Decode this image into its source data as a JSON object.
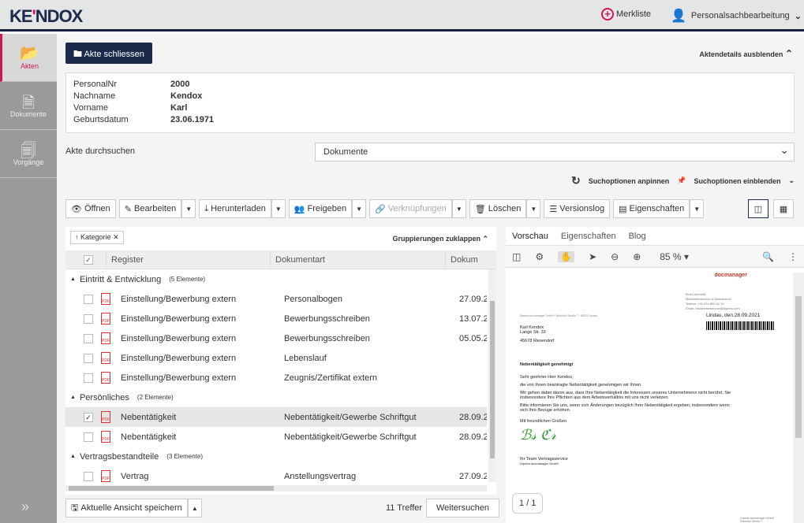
{
  "header": {
    "logo": "KENDOX",
    "merkliste": "Merkliste",
    "user": "Personalsachbearbeitung"
  },
  "sidebar": {
    "items": [
      {
        "label": "Akten",
        "icon": "folder-open-icon"
      },
      {
        "label": "Dokumente",
        "icon": "document-icon"
      },
      {
        "label": "Vorgänge",
        "icon": "process-icon"
      }
    ]
  },
  "main": {
    "close_button": "Akte schliessen",
    "details_toggle": "Aktendetails ausblenden",
    "details": [
      {
        "label": "PersonalNr",
        "value": "2000"
      },
      {
        "label": "Nachname",
        "value": "Kendox"
      },
      {
        "label": "Vorname",
        "value": "Karl"
      },
      {
        "label": "Geburtsdatum",
        "value": "23.06.1971"
      }
    ],
    "search_label": "Akte durchsuchen",
    "search_select": "Dokumente",
    "pin_options": "Suchoptionen anpinnen",
    "show_options": "Suchoptionen einblenden",
    "toolbar": {
      "open": "Öffnen",
      "edit": "Bearbeiten",
      "download": "Herunterladen",
      "share": "Freigeben",
      "links": "Verknüpfungen",
      "delete": "Löschen",
      "versionlog": "Versionslog",
      "properties": "Eigenschaften"
    },
    "list": {
      "chip": "Kategorie",
      "collapse_groups": "Gruppierungen zuklappen",
      "columns": [
        "Register",
        "Dokumentart",
        "Dokum"
      ],
      "groups": [
        {
          "name": "Eintritt & Entwicklung",
          "count": "(5 Elemente)",
          "rows": [
            {
              "register": "Einstellung/Bewerbung extern",
              "type": "Personalbogen",
              "date": "27.09.2",
              "checked": false
            },
            {
              "register": "Einstellung/Bewerbung extern",
              "type": "Bewerbungsschreiben",
              "date": "13.07.2",
              "checked": false
            },
            {
              "register": "Einstellung/Bewerbung extern",
              "type": "Bewerbungsschreiben",
              "date": "05.05.2",
              "checked": false
            },
            {
              "register": "Einstellung/Bewerbung extern",
              "type": "Lebenslauf",
              "date": "",
              "checked": false
            },
            {
              "register": "Einstellung/Bewerbung extern",
              "type": "Zeugnis/Zertifikat extern",
              "date": "",
              "checked": false
            }
          ]
        },
        {
          "name": "Persönliches",
          "count": "(2 Elemente)",
          "rows": [
            {
              "register": "Nebentätigkeit",
              "type": "Nebentätigkeit/Gewerbe Schriftgut",
              "date": "28.09.2",
              "checked": true
            },
            {
              "register": "Nebentätigkeit",
              "type": "Nebentätigkeit/Gewerbe Schriftgut",
              "date": "28.09.2",
              "checked": false
            }
          ]
        },
        {
          "name": "Vertragsbestandteile",
          "count": "(3 Elemente)",
          "rows": [
            {
              "register": "Vertrag",
              "type": "Anstellungsvertrag",
              "date": "27.09.2",
              "checked": false
            }
          ]
        }
      ]
    },
    "save_view": "Aktuelle Ansicht speichern",
    "hits": "11 Treffer",
    "search_more": "Weitersuchen"
  },
  "preview": {
    "tabs": [
      "Vorschau",
      "Eigenschaften",
      "Blog"
    ],
    "zoom": "85 %",
    "page": "1 / 1",
    "doc": {
      "brand": "docmanager",
      "sender_line": "Diperia docmanager GmbH * Bahnhof-Straße 7 * 88131 Lindau",
      "contact": [
        "Ihnen schreibt:",
        "Mitarbeiterservice & Arbeitsrecht",
        "Telefon: +49 234 800 81 10",
        "Email: mitarbeiterservice@diperia.com"
      ],
      "date": "Lindau, den 28.09.2021",
      "address": [
        "Karl Kendox",
        "Lange Str. 33",
        "45678 Riesendorf"
      ],
      "subject": "Nebentätigkeit genehmigt",
      "body": [
        "Sehr geehrter Herr Kendox,",
        "die von Ihnen beantragte Nebentätigkeit genehmigen wir Ihnen.",
        "Wir gehen dabei davon aus, dass Ihre Nebentätigkeit die Interessen unseres Unternehmens nicht berührt, Sie insbesondere Ihre Pflichten aus dem Arbeitsverhältnis mit uns nicht verletzen.",
        "Bitte informieren Sie uns, wenn sich Änderungen bezüglich Ihrer Nebentätigkeit ergeben, insbesondere wenn sich Ihre Bezüge erhöhen.",
        "Mit freundlichen Grüßen"
      ],
      "signoff": [
        "Ihr Team Vertragsservice",
        "Diperia docmanager GmbH"
      ],
      "footer": [
        "Diperia docmanager GmbH",
        "Bahnhof-Straße 7"
      ]
    }
  },
  "colors": {
    "accent": "#d4145a",
    "navy": "#1b2a4a"
  }
}
